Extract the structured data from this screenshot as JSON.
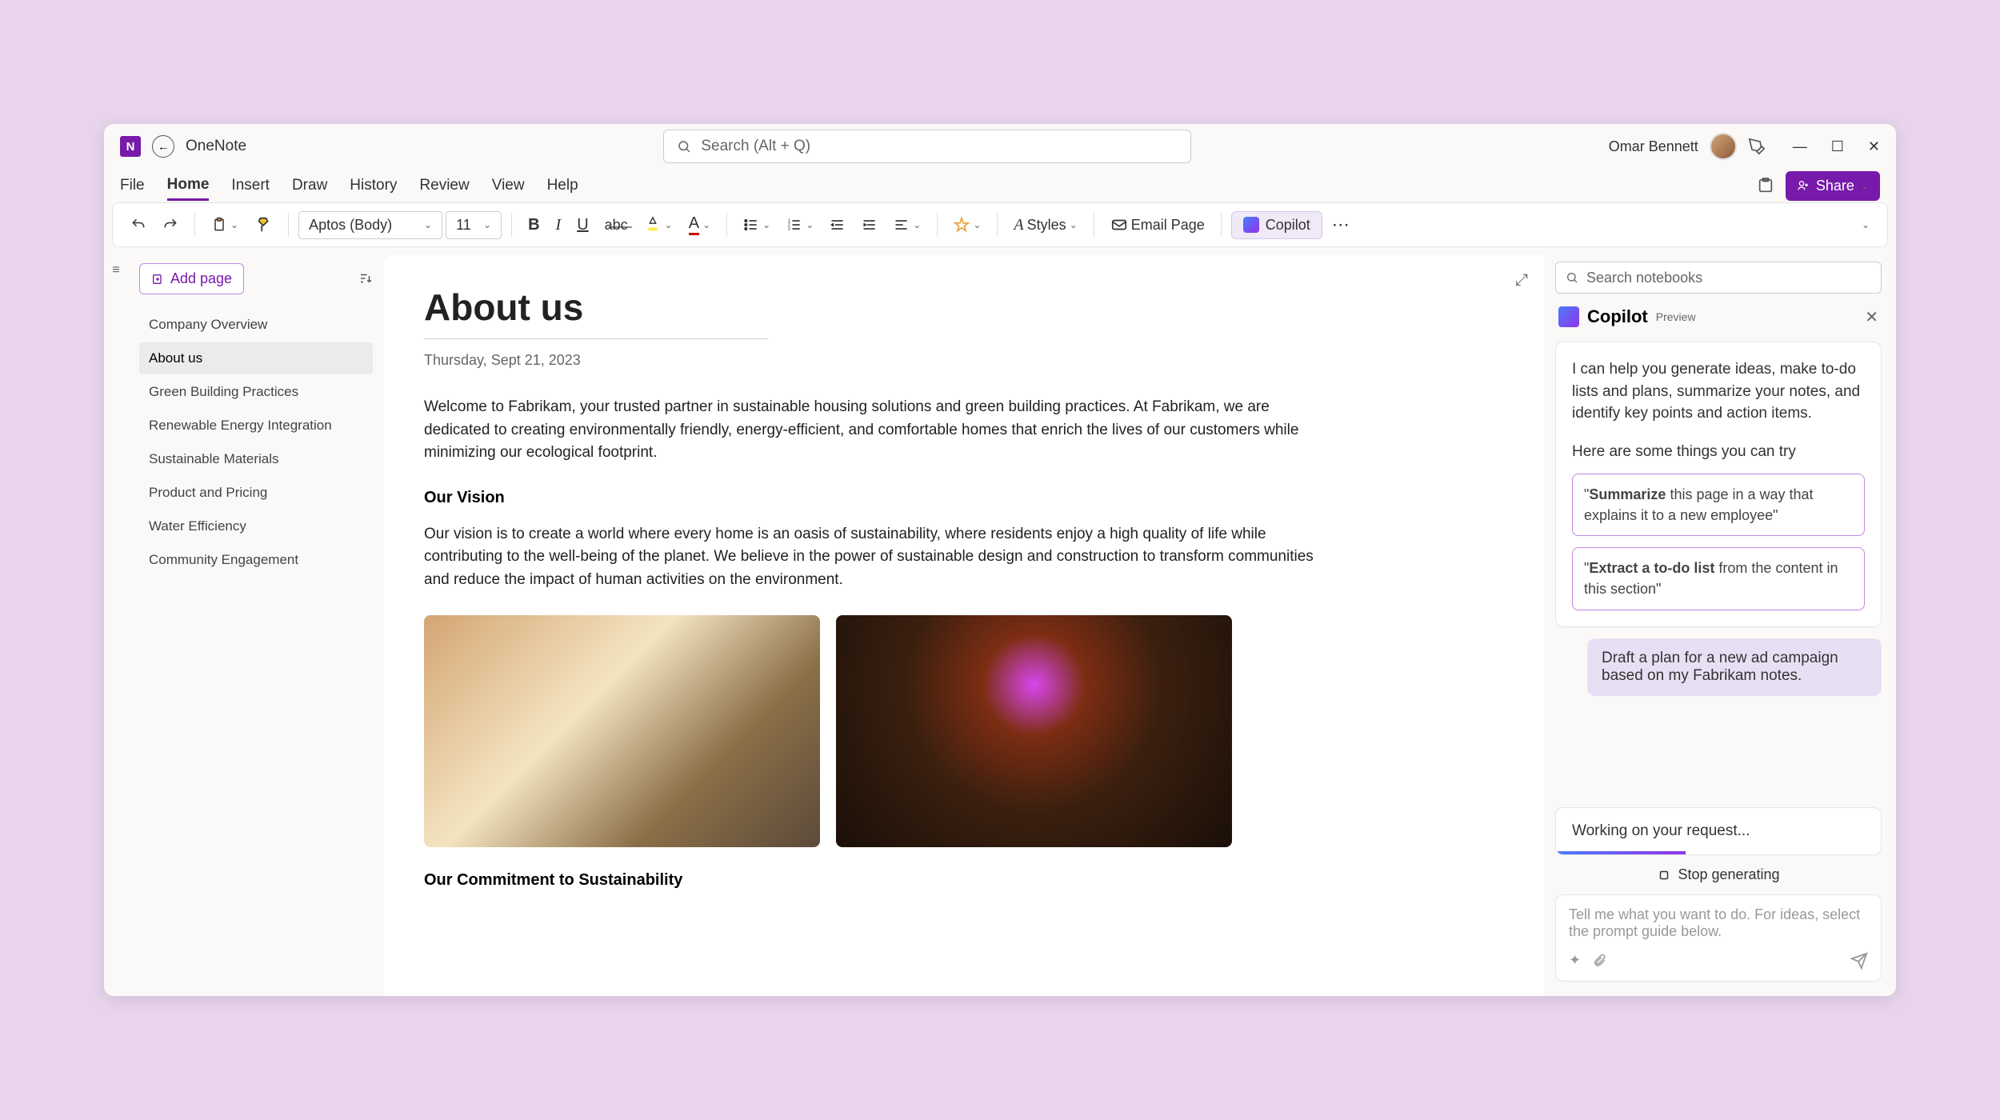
{
  "titlebar": {
    "app_name": "OneNote",
    "search_placeholder": "Search (Alt + Q)",
    "user_name": "Omar Bennett"
  },
  "menu": {
    "tabs": [
      "File",
      "Home",
      "Insert",
      "Draw",
      "History",
      "Review",
      "View",
      "Help"
    ],
    "active_index": 1,
    "share_label": "Share"
  },
  "ribbon": {
    "font_name": "Aptos (Body)",
    "font_size": "11",
    "styles_label": "Styles",
    "email_label": "Email Page",
    "copilot_label": "Copilot"
  },
  "notebook_search_placeholder": "Search notebooks",
  "sidebar": {
    "add_page_label": "Add page",
    "pages": [
      "Company Overview",
      "About us",
      "Green Building Practices",
      "Renewable Energy Integration",
      "Sustainable Materials",
      "Product and Pricing",
      "Water Efficiency",
      "Community Engagement"
    ],
    "active_index": 1
  },
  "page": {
    "title": "About us",
    "date": "Thursday, Sept 21, 2023",
    "intro": "Welcome to Fabrikam, your trusted partner in sustainable housing solutions and green building practices. At Fabrikam, we are dedicated to creating environmentally friendly, energy-efficient, and comfortable homes that enrich the lives of our customers while minimizing our ecological footprint.",
    "vision_heading": "Our Vision",
    "vision_body": "Our vision is to create a world where every home is an oasis of sustainability, where residents enjoy a high quality of life while contributing to the well-being of the planet. We believe in the power of sustainable design and construction to transform communities and reduce the impact of human activities on the environment.",
    "commitment_heading": "Our Commitment to Sustainability"
  },
  "copilot": {
    "title": "Copilot",
    "preview_badge": "Preview",
    "intro": "I can help you generate ideas, make to-do lists and plans, summarize your notes, and identify key points and action items.",
    "try_label": "Here are some things you can try",
    "sugg1_bold": "Summarize",
    "sugg1_rest": " this page in a way that explains it to a new employee\"",
    "sugg2_bold": "Extract a to-do list",
    "sugg2_rest": " from the content in this section\"",
    "user_msg": "Draft a plan for a new ad campaign based on my Fabrikam notes.",
    "working_label": "Working on your request...",
    "stop_label": "Stop generating",
    "input_placeholder": "Tell me what you want to do. For ideas, select the prompt guide below."
  }
}
